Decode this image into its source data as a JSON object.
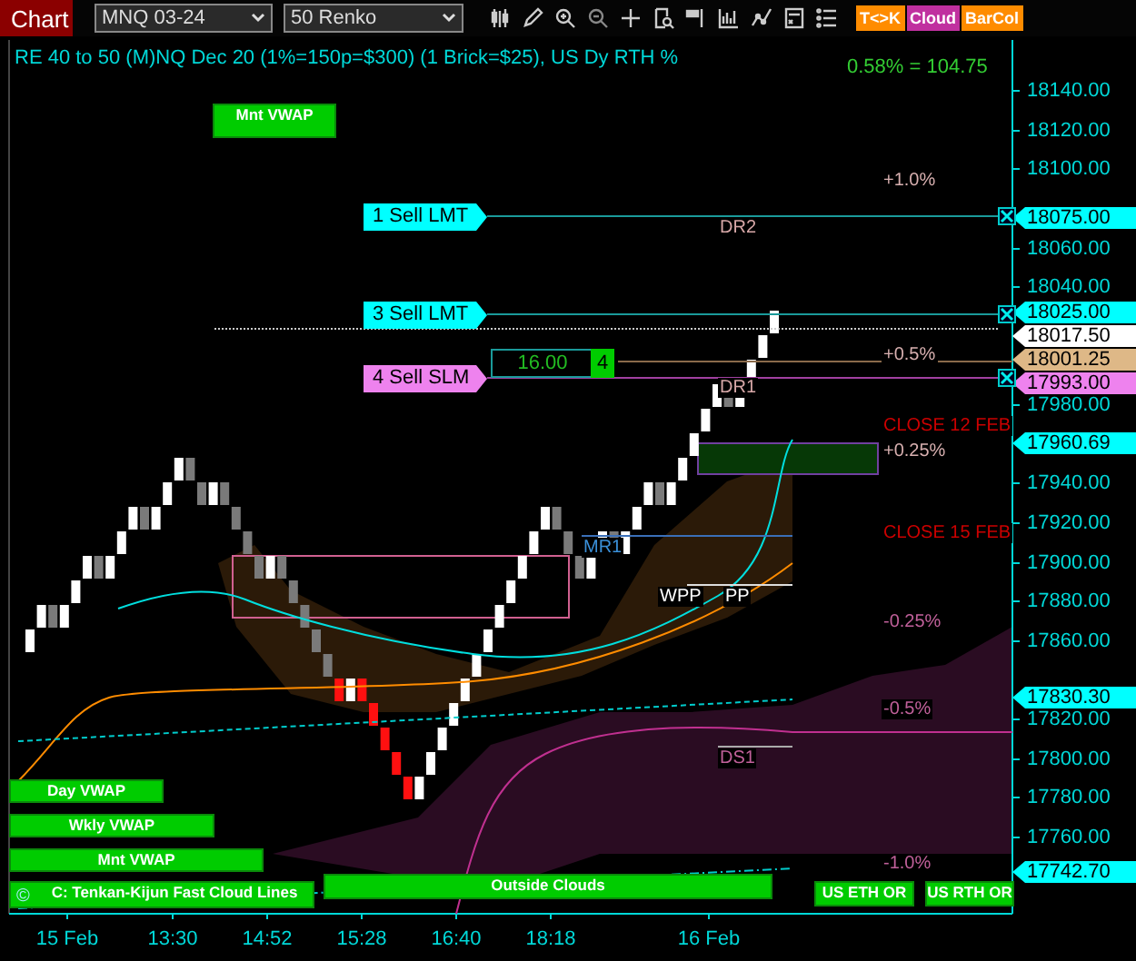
{
  "toolbar": {
    "title": "Chart",
    "instrument": "MNQ 03-24",
    "bar_type": "50 Renko",
    "toggles": [
      {
        "label": "T<>K",
        "color": "#ff8c00"
      },
      {
        "label": "Cloud",
        "color": "#c0309f"
      },
      {
        "label": "BarCol",
        "color": "#ff8c00"
      }
    ]
  },
  "chart": {
    "title": "RE 40 to 50 (M)NQ Dec 20 (1%=150p=$300) (1 Brick=$25), US Dy RTH %",
    "change": "0.58% = 104.75",
    "y_axis": [
      "18140.00",
      "18120.00",
      "18100.00",
      "18060.00",
      "18040.00",
      "17980.00",
      "17940.00",
      "17920.00",
      "17900.00",
      "17880.00",
      "17860.00",
      "17820.00",
      "17800.00",
      "17780.00",
      "17760.00"
    ],
    "x_axis": [
      "15 Feb",
      "13:30",
      "14:52",
      "15:28",
      "16:40",
      "18:18",
      "16 Feb"
    ],
    "price_markers": [
      {
        "label": "18075.00",
        "color": "#00ffff"
      },
      {
        "label": "18025.00",
        "color": "#00ffff"
      },
      {
        "label": "18017.50",
        "color": "#ffffff"
      },
      {
        "label": "18001.25",
        "color": "#deb887"
      },
      {
        "label": "17993.00",
        "color": "#ee82ee"
      },
      {
        "label": "17960.69",
        "color": "#00ffff"
      },
      {
        "label": "17830.30",
        "color": "#00ffff"
      },
      {
        "label": "17742.70",
        "color": "#00ffff"
      }
    ],
    "orders": [
      {
        "label": "1 Sell LMT",
        "color": "#00ffff"
      },
      {
        "label": "3 Sell LMT",
        "color": "#00ffff"
      },
      {
        "label": "4 Sell SLM",
        "color": "#ee82ee"
      }
    ],
    "position": {
      "price": "16.00",
      "quantity": "4"
    },
    "level_labels": [
      {
        "text": "+1.0%",
        "kind": "gain"
      },
      {
        "text": "DR2",
        "kind": "resistance"
      },
      {
        "text": "+0.5%",
        "kind": "gain"
      },
      {
        "text": "DR1",
        "kind": "resistance"
      },
      {
        "text": "CLOSE 12 FEB",
        "kind": "close"
      },
      {
        "text": "+0.25%",
        "kind": "gain"
      },
      {
        "text": "CLOSE 15 FEB",
        "kind": "close"
      },
      {
        "text": "MR1",
        "kind": "monthly"
      },
      {
        "text": "WPP",
        "kind": "pivot"
      },
      {
        "text": "PP",
        "kind": "pivot"
      },
      {
        "text": "-0.25%",
        "kind": "loss"
      },
      {
        "text": "-0.5%",
        "kind": "loss"
      },
      {
        "text": "DS1",
        "kind": "support"
      },
      {
        "text": "-1.0%",
        "kind": "loss"
      }
    ],
    "indicator_labels": [
      {
        "label": "Mnt VWAP"
      },
      {
        "label": "Day VWAP"
      },
      {
        "label": "Wkly VWAP"
      },
      {
        "label": "Mnt VWAP"
      },
      {
        "label": "C: Tenkan-Kijun Fast Cloud Lines",
        "prefix": "©"
      },
      {
        "label": "Outside Clouds"
      },
      {
        "label": "US ETH OR"
      },
      {
        "label": "US RTH OR"
      }
    ]
  }
}
